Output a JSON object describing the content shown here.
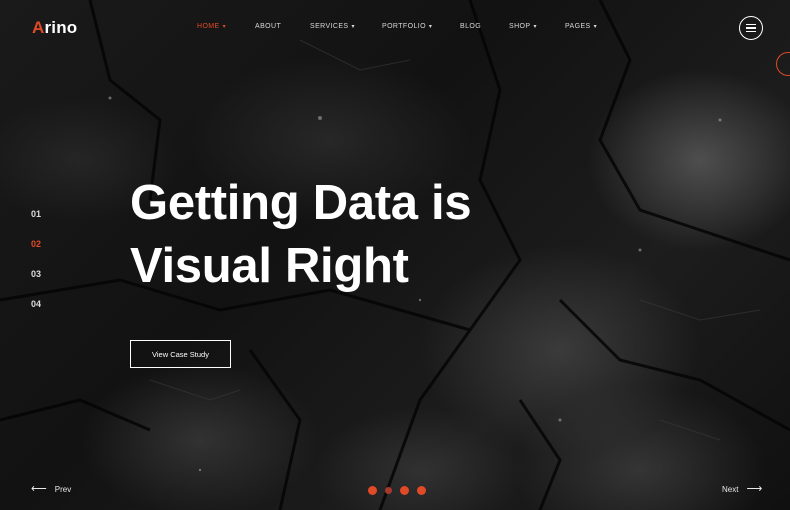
{
  "logo": {
    "accent_letter": "A",
    "rest": "rino"
  },
  "nav": {
    "items": [
      {
        "label": "HOME",
        "caret": "▾"
      },
      {
        "label": "ABOUT",
        "caret": ""
      },
      {
        "label": "SERVICES",
        "caret": "▾"
      },
      {
        "label": "PORTFOLIO",
        "caret": "▾"
      },
      {
        "label": "BLOG",
        "caret": ""
      },
      {
        "label": "SHOP",
        "caret": "▾"
      },
      {
        "label": "PAGES",
        "caret": "▾"
      }
    ],
    "active_index": 0
  },
  "slides": {
    "numbers": [
      "01",
      "02",
      "03",
      "04"
    ],
    "active_index": 1
  },
  "hero": {
    "title_line1": "Getting Data is",
    "title_line2": "Visual Right",
    "cta_label": "View Case Study"
  },
  "pager": {
    "prev_label": "Prev",
    "next_label": "Next",
    "prev_arrow": "⟵",
    "next_arrow": "⟶",
    "dot_count": 4,
    "active_dot": 1
  },
  "colors": {
    "accent": "#e04a26",
    "background": "#0d0d0d",
    "text": "#ffffff"
  },
  "icons": {
    "menu": "hamburger-menu-icon",
    "side": "circle-outline-icon"
  }
}
